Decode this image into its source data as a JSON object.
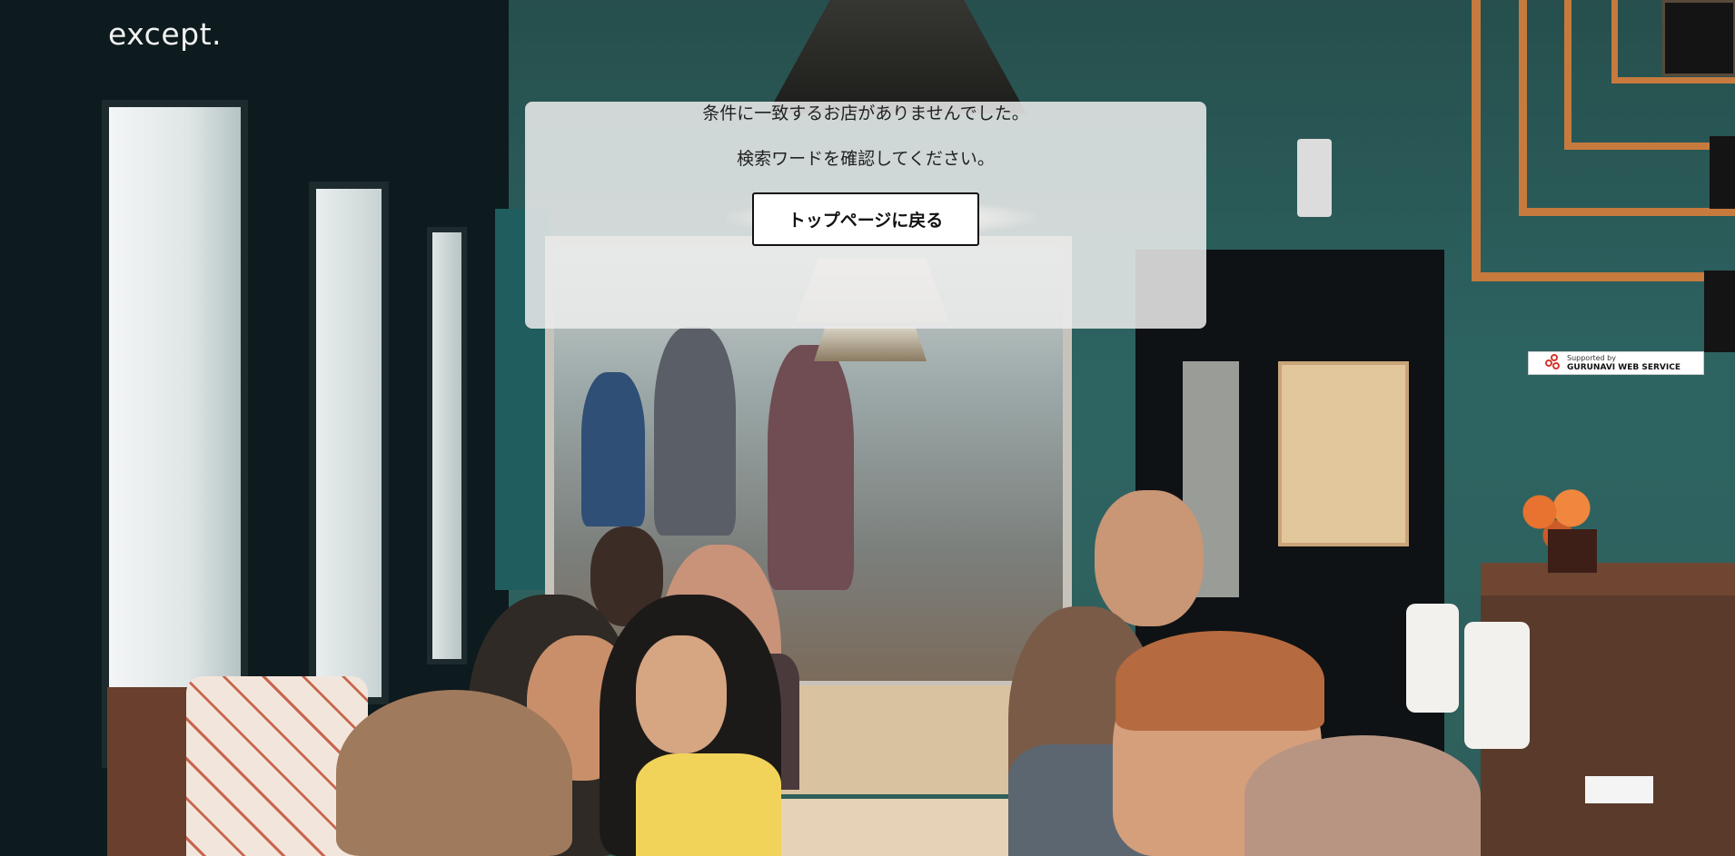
{
  "brand": {
    "logo_text": "except."
  },
  "dialog": {
    "message_no_results": "条件に一致するお店がありませんでした。",
    "message_check_keyword": "検索ワードを確認してください。",
    "back_button_label": "トップページに戻る"
  },
  "credit": {
    "supported_by": "Supported by",
    "service_name": "GURUNAVI WEB SERVICE",
    "icon": "gurunavi-logo-icon",
    "accent_color": "#d4362c"
  },
  "colors": {
    "dialog_background": "#ececec",
    "button_border": "#111111",
    "logo_text": "#f1f1f1"
  }
}
